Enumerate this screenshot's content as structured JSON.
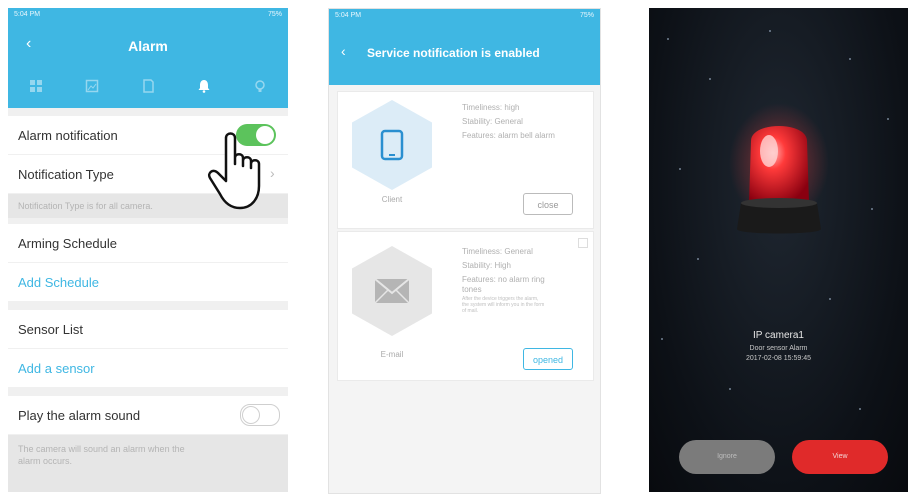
{
  "screen1": {
    "status_time": "5:04 PM",
    "status_right": "75%",
    "title": "Alarm",
    "rows": {
      "alarm_notification": "Alarm notification",
      "notification_type": "Notification Type",
      "notification_hint": "Notification Type is for all camera.",
      "arming_schedule": "Arming Schedule",
      "add_schedule": "Add Schedule",
      "sensor_list": "Sensor List",
      "add_sensor": "Add a sensor",
      "play_sound": "Play the alarm sound",
      "sound_hint_1": "The camera will sound an alarm when the",
      "sound_hint_2": "alarm occurs."
    },
    "alarm_notification_on": true,
    "play_sound_on": false
  },
  "screen2": {
    "status_time": "5:04 PM",
    "status_right": "75%",
    "title": "Service notification is enabled",
    "client": {
      "caption": "Client",
      "line1": "Timeliness: high",
      "line2": "Stability: General",
      "line3": "Features: alarm bell alarm",
      "button": "close"
    },
    "email": {
      "caption": "E-mail",
      "line1": "Timeliness: General",
      "line2": "Stability: High",
      "line3": "Features: no alarm ring",
      "line4": "tones",
      "note_1": "After the device triggers the alarm,",
      "note_2": "the system will inform you in the form",
      "note_3": "of mail.",
      "button": "opened"
    }
  },
  "screen3": {
    "camera": "IP camera1",
    "event": "Door sensor Alarm",
    "datetime": "2017-02-08 15:59:45",
    "ignore": "Ignore",
    "view": "View"
  },
  "colors": {
    "accent": "#3fb7e3",
    "toggle_on": "#5cc35c",
    "alarm_red": "#e02a2a",
    "ignore_gray": "#7b7b7b"
  }
}
